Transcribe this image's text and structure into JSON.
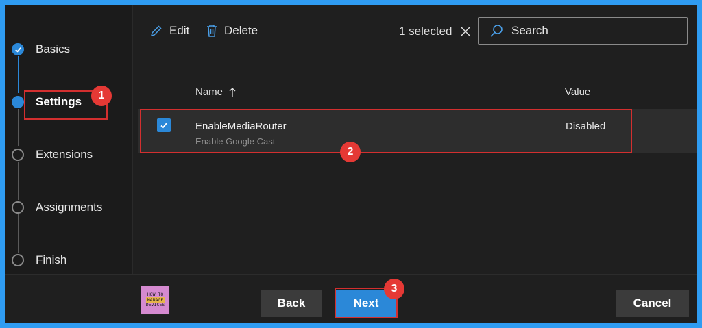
{
  "wizard": {
    "steps": [
      {
        "label": "Basics",
        "state": "done"
      },
      {
        "label": "Settings",
        "state": "current"
      },
      {
        "label": "Extensions",
        "state": "pending"
      },
      {
        "label": "Assignments",
        "state": "pending"
      },
      {
        "label": "Finish",
        "state": "pending"
      }
    ]
  },
  "toolbar": {
    "edit_label": "Edit",
    "delete_label": "Delete",
    "selected_text": "1 selected",
    "search_placeholder": "Search"
  },
  "table": {
    "columns": {
      "name": "Name",
      "value": "Value"
    },
    "rows": [
      {
        "name": "EnableMediaRouter",
        "description": "Enable Google Cast",
        "value": "Disabled",
        "checked": true
      }
    ]
  },
  "footer": {
    "back_label": "Back",
    "next_label": "Next",
    "cancel_label": "Cancel",
    "logo_lines": [
      "HOW TO",
      "MANAGE",
      "DEVICES"
    ]
  },
  "annotations": {
    "markers": [
      "1",
      "2",
      "3"
    ]
  },
  "colors": {
    "accent": "#2b88d8",
    "highlight": "#d32f2f",
    "frame_border": "#2f9cf2"
  }
}
